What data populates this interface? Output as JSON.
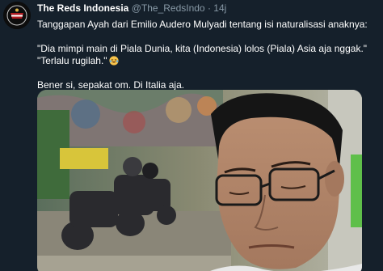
{
  "tweet": {
    "display_name": "The Reds Indonesia",
    "handle": "@The_RedsIndo",
    "separator": "·",
    "time": "14j",
    "lines": [
      "Tanggapan Ayah dari Emilio Audero Mulyadi tentang isi naturalisasi anaknya:",
      "\"Dia mimpi main di Piala Dunia, kita (Indonesia) lolos (Piala) Asia aja nggak.\"",
      "\"Terlalu rugilah.\"",
      "Bener si, sepakat om. Di Italia aja."
    ],
    "emoji": "laughing-tears-emoji"
  },
  "media": {
    "description_icon": "photo-icon"
  },
  "colors": {
    "background": "#15202b",
    "secondary_text": "#8899a6",
    "primary_text": "#ffffff"
  }
}
